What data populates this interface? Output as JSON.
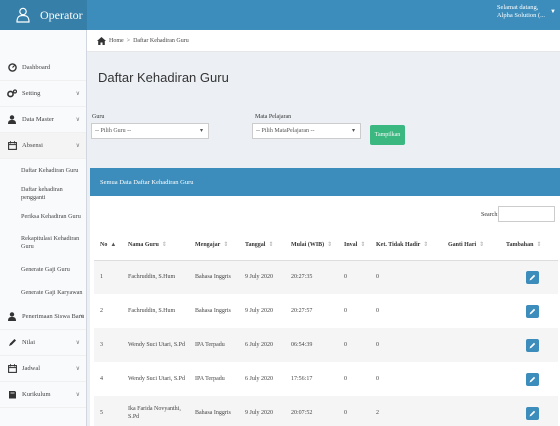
{
  "app": {
    "title": "Operator"
  },
  "user": {
    "greeting": "Selamat datang,",
    "name": "Alpha Solution (..."
  },
  "sidebar": {
    "items": [
      {
        "label": "Dashboard"
      },
      {
        "label": "Setting"
      },
      {
        "label": "Data Master"
      },
      {
        "label": "Absensi"
      },
      {
        "label": "Penerimaan Siswa Baru"
      },
      {
        "label": "Nilai"
      },
      {
        "label": "Jadwal"
      },
      {
        "label": "Kurikulum"
      }
    ],
    "subitems": [
      {
        "label": "Daftar Kehadiran Guru"
      },
      {
        "label": "Daftar kehadiran pengganti"
      },
      {
        "label": "Periksa Kehadiran Guru"
      },
      {
        "label": "Rekapitulasi Kehadiran Guru"
      },
      {
        "label": "Generate Gaji Guru"
      },
      {
        "label": "Generate Gaji Karyawan"
      }
    ]
  },
  "breadcrumb": {
    "home": "Home",
    "sep": ">",
    "current": "Daftar Kehadiran Guru"
  },
  "page": {
    "title": "Daftar Kehadiran Guru"
  },
  "filters": {
    "guru_label": "Guru",
    "guru_value": "-- Pilih Guru --",
    "mapel_label": "Mata Pelajaran",
    "mapel_value": "-- Pilih MataPelajaran --",
    "submit": "Tampilkan"
  },
  "box": {
    "title": "Semua Data Daftar Kehadiran Guru"
  },
  "search": {
    "label": "Search:"
  },
  "table": {
    "headers": [
      "No",
      "Nama Guru",
      "Mengajar",
      "Tanggal",
      "Mulai (WIB)",
      "Inval",
      "Ket. Tidak Hadir",
      "Ganti Hari",
      "Tambahan"
    ],
    "rows": [
      [
        "1",
        "Fachruddin, S.Hum",
        "Bahasa Inggris",
        "9 July 2020",
        "20:27:35",
        "0",
        "0",
        ""
      ],
      [
        "2",
        "Fachruddin, S.Hum",
        "Bahasa Inggris",
        "9 July 2020",
        "20:27:57",
        "0",
        "0",
        ""
      ],
      [
        "3",
        "Wendy Suci Utari, S.Pd",
        "IPA Terpadu",
        "6 July 2020",
        "06:54:39",
        "0",
        "0",
        ""
      ],
      [
        "4",
        "Wendy Suci Utari, S.Pd",
        "IPA Terpadu",
        "6 July 2020",
        "17:56:17",
        "0",
        "0",
        ""
      ],
      [
        "5",
        "Ika Farida Novyanthi, S.Pd",
        "Bahasa Inggris",
        "9 July 2020",
        "20:07:52",
        "0",
        "2",
        ""
      ]
    ]
  },
  "colors": {
    "header": "#3c8dbc",
    "brand": "#367fa9",
    "success": "#00a65a"
  }
}
